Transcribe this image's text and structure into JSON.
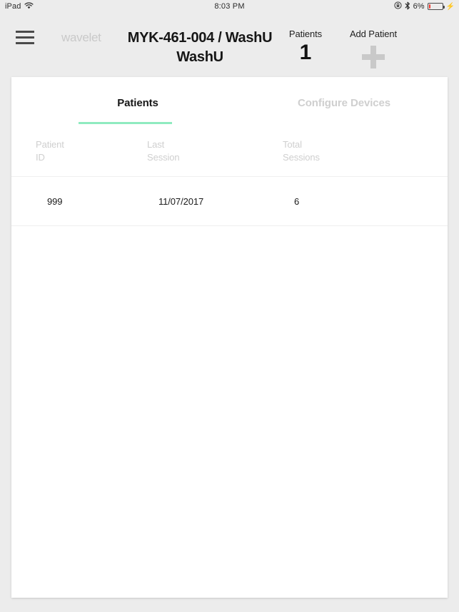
{
  "status_bar": {
    "device": "iPad",
    "wifi_icon": "wifi-icon",
    "time": "8:03 PM",
    "rotation_lock_icon": "rotation-lock-icon",
    "bluetooth_icon": "bluetooth-icon",
    "battery_percent": "6%",
    "battery_level": 6,
    "battery_color": "#f5372e",
    "charging_icon": "charging-bolt-icon"
  },
  "header": {
    "menu_icon": "hamburger-menu-icon",
    "brand": "wavelet",
    "title": "MYK-461-004 / WashU WashU",
    "patients_label": "Patients",
    "patients_count": "1",
    "add_patient_label": "Add Patient",
    "add_patient_icon": "plus-icon"
  },
  "tabs": {
    "active_label": "Patients",
    "inactive_label": "Configure Devices",
    "active_accent_color": "#8febc0"
  },
  "table": {
    "columns": [
      {
        "label": "Patient\nID"
      },
      {
        "label": "Last\nSession"
      },
      {
        "label": "Total\nSessions"
      }
    ],
    "rows": [
      {
        "patient_id": "999",
        "last_session": "11/07/2017",
        "total_sessions": "6"
      }
    ]
  }
}
